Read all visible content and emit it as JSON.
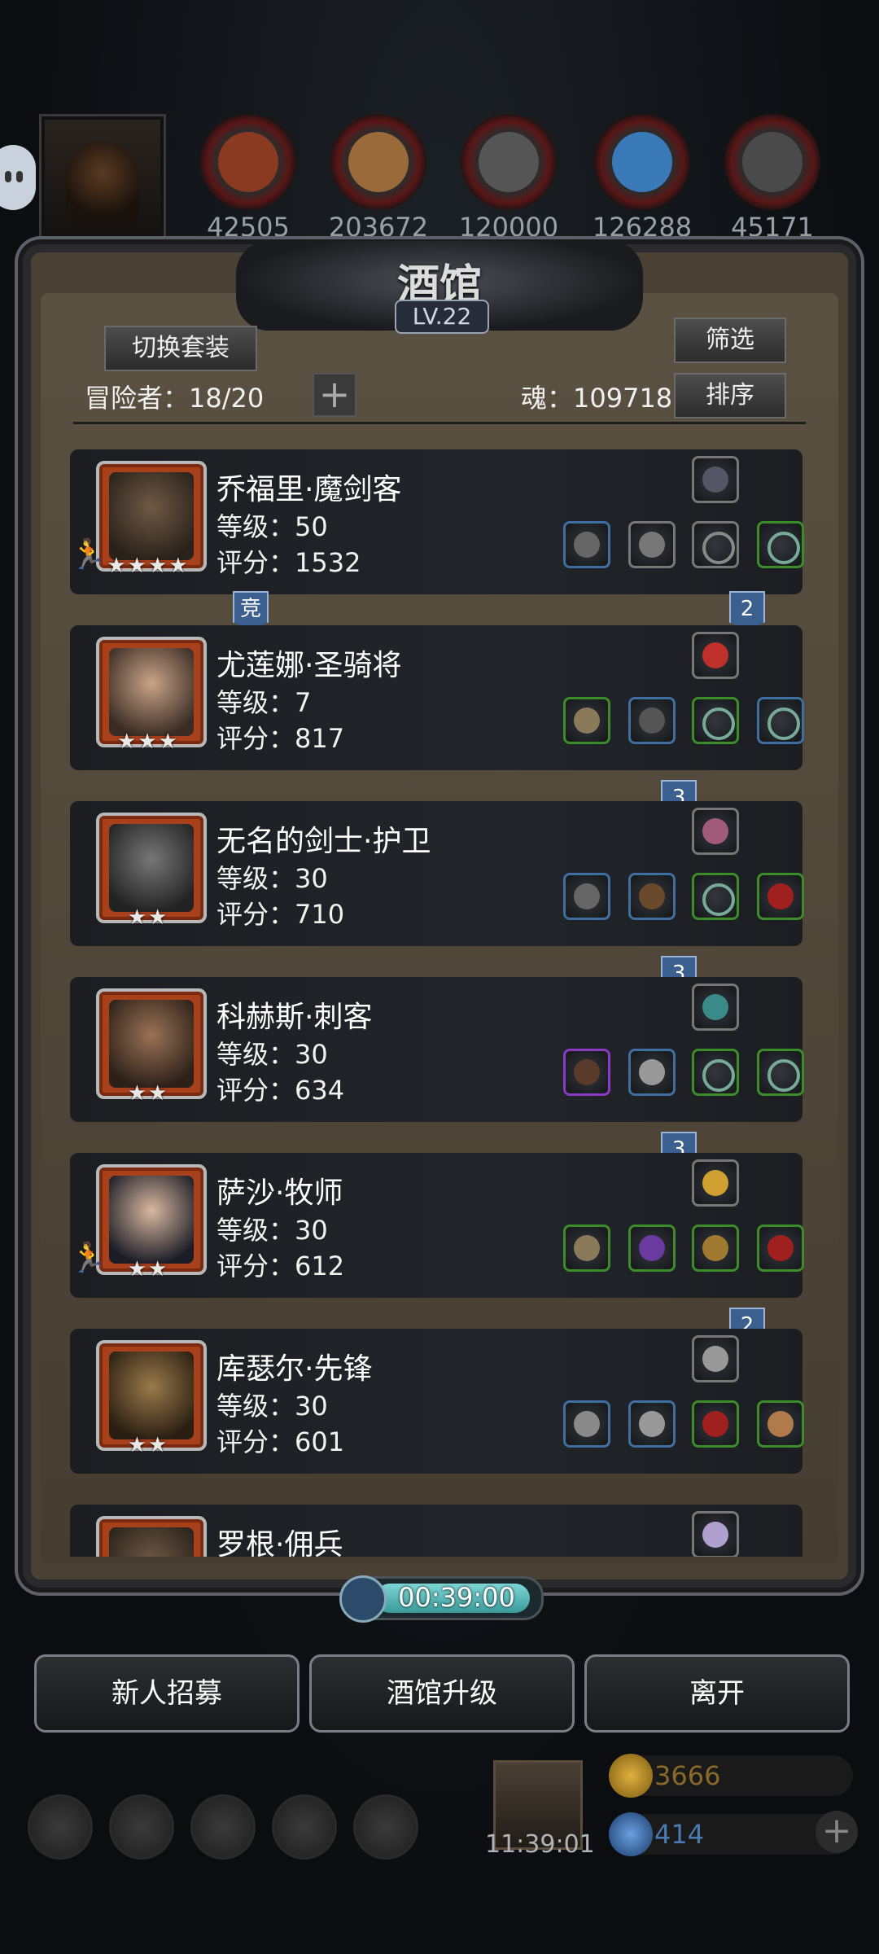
{
  "resources": [
    {
      "icon": "meat-icon",
      "value": "42505",
      "color": "#8a3a20"
    },
    {
      "icon": "wood-icon",
      "value": "203672",
      "color": "#9a6a3a"
    },
    {
      "icon": "stone-icon",
      "value": "120000",
      "color": "#555555"
    },
    {
      "icon": "crystal-icon",
      "value": "126288",
      "color": "#3a7ab8"
    },
    {
      "icon": "iron-icon",
      "value": "45171",
      "color": "#4a4a4a"
    }
  ],
  "tavern": {
    "title": "酒馆",
    "level": "LV.22",
    "switch_outfit": "切换套装",
    "filter": "筛选",
    "sort": "排序",
    "adventurers_label": "冒险者：18/20",
    "soul_label": "魂：109718"
  },
  "adventurers": [
    {
      "name": "乔福里·魔剑客",
      "level": "等级：50",
      "score": "评分：1532",
      "stars": "★★★★"
    },
    {
      "name": "尤莲娜·圣骑将",
      "level": "等级：7",
      "score": "评分：817",
      "stars": "★★★"
    },
    {
      "name": "无名的剑士·护卫",
      "level": "等级：30",
      "score": "评分：710",
      "stars": "★★"
    },
    {
      "name": "科赫斯·刺客",
      "level": "等级：30",
      "score": "评分：634",
      "stars": "★★"
    },
    {
      "name": "萨沙·牧师",
      "level": "等级：30",
      "score": "评分：612",
      "stars": "★★"
    },
    {
      "name": "库瑟尔·先锋",
      "level": "等级：30",
      "score": "评分：601",
      "stars": "★★"
    },
    {
      "name": "罗根·佣兵",
      "level": "",
      "score": "",
      "stars": ""
    }
  ],
  "tags": [
    "竞",
    "2",
    "3",
    "3",
    "3",
    "2"
  ],
  "timer": "00:39:00",
  "buttons": {
    "recruit": "新人招募",
    "upgrade": "酒馆升级",
    "leave": "离开"
  },
  "bottom": {
    "clock": "11:39:01",
    "gold": "3666",
    "gems": "414"
  }
}
